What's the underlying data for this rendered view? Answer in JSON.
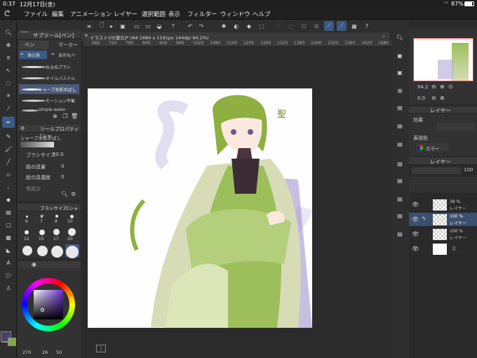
{
  "status": {
    "time": "0:37",
    "date": "12月17日(金)",
    "battery": "87%"
  },
  "menu": [
    "ファイル",
    "編集",
    "アニメーション",
    "レイヤー",
    "選択範囲",
    "表示",
    "フィルター",
    "ウィンドウ",
    "ヘルプ"
  ],
  "subtool": {
    "title": "サブツール[ペン]",
    "tabs": [
      "ペン",
      "マーカー"
    ],
    "tab2": [
      "筆記筆",
      "自作丸ペ"
    ],
    "brushes": [
      "ぬるぬブラシ",
      "オイルパステル",
      "シャープ水彩のばし",
      "モーション平筆",
      "simple water"
    ]
  },
  "toolprop": {
    "title": "ツールプロパティ[シャ",
    "brush_name": "シャープ水彩のばし",
    "size_label": "ブラシサイズ",
    "size_value": "50.0",
    "paint_label": "絵の具量",
    "paint_value": "0",
    "density_label": "絵の具濃度",
    "density_value": "0",
    "mix_label": "色延び"
  },
  "brushsize": {
    "title": "ブラシサイズ[シャー",
    "row1": [
      "6",
      "7",
      "8",
      "10"
    ],
    "row2": [
      "12",
      "15",
      "17",
      "20"
    ]
  },
  "color": {
    "values": [
      "270",
      "26",
      "50"
    ],
    "main": "#4a4068",
    "sub": "#ffffff",
    "accent": "#3b5a86"
  },
  "doc": {
    "title": "イラスト15[復元]* (A4 1684 x 1191px 144dpi 94.2%)",
    "ruler": [
      "660",
      "720",
      "780",
      "840",
      "900",
      "960",
      "1020",
      "1080",
      "1140",
      "1200",
      "1260",
      "1320",
      "1380",
      "1440",
      "1500",
      "1560",
      "1620",
      "1680"
    ]
  },
  "navigator": {
    "zoom": "94.2",
    "rotate": "0.0"
  },
  "layer": {
    "title": "レイヤー",
    "effect": "効果",
    "blend_label": "表現色",
    "blend_value": "カラー",
    "opacity": "100"
  },
  "layers": [
    {
      "pct": "38 %",
      "name": "レイヤー"
    },
    {
      "pct": "100 %",
      "name": "レイヤー"
    },
    {
      "pct": "100 %",
      "name": "レイヤー"
    },
    {
      "pct": "",
      "name": ""
    }
  ],
  "signature": "聖"
}
